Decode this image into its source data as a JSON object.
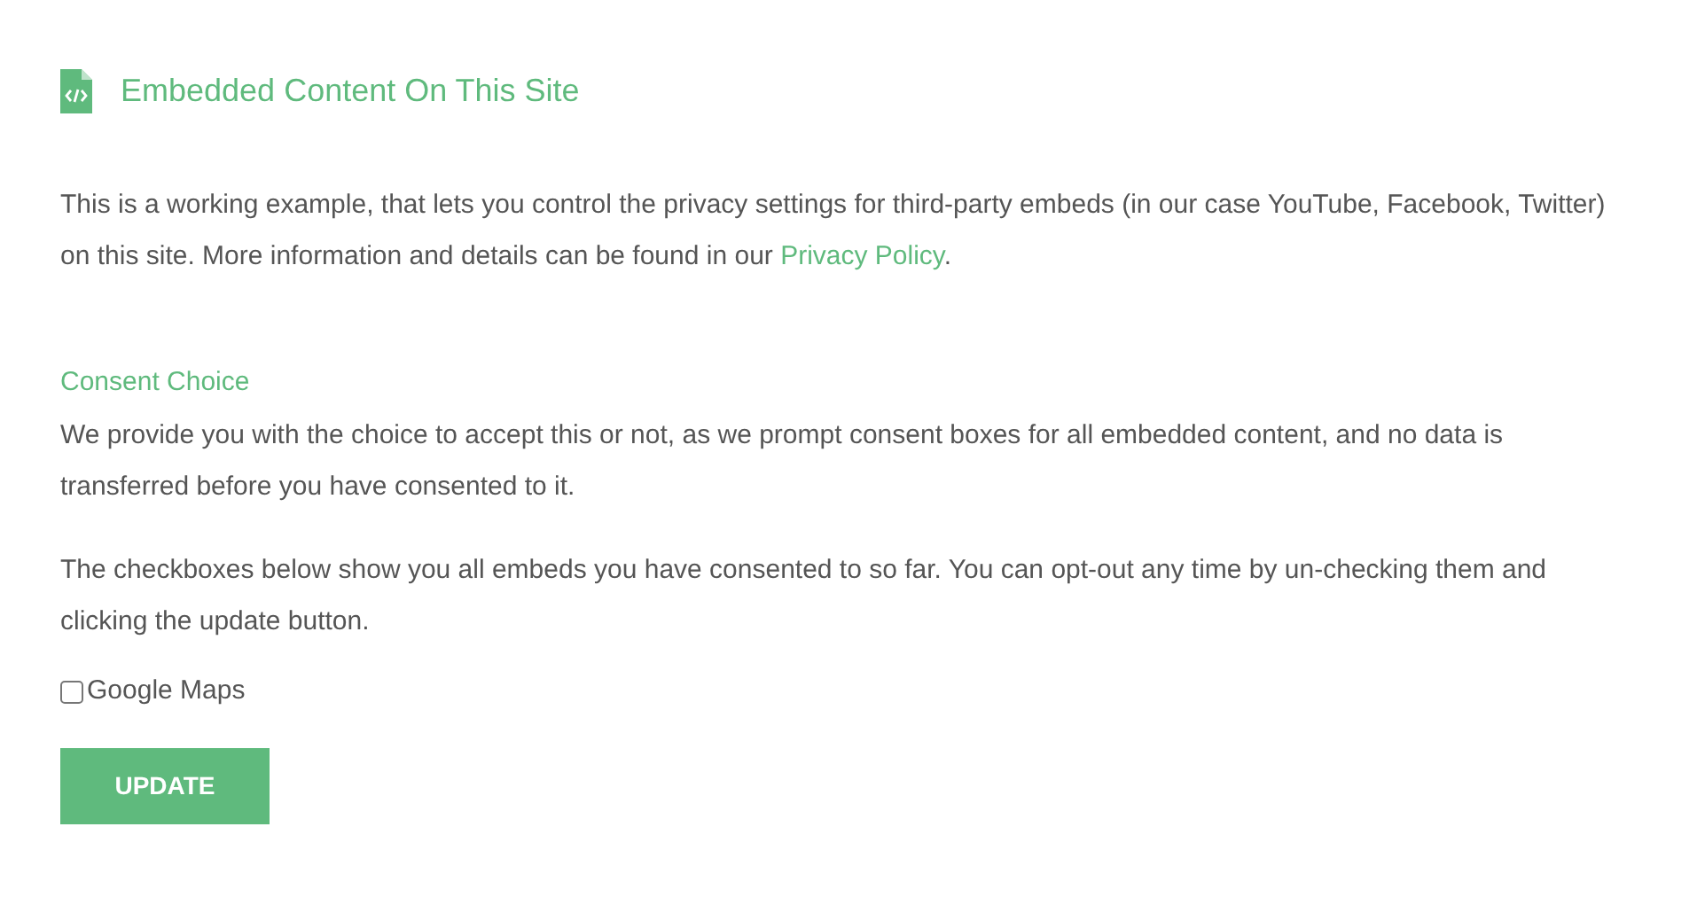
{
  "title": "Embedded Content On This Site",
  "intro": {
    "text": "This is a working example, that lets you control the privacy settings for third-party embeds (in our case YouTube, Facebook, Twitter) on this site. More information and details can be found in our ",
    "link": "Privacy Policy",
    "end": "."
  },
  "section_heading": "Consent Choice",
  "paragraphs": [
    "We provide you with the choice to accept this or not, as we prompt consent boxes for all embedded content, and no data is transferred before you have consented to it.",
    "The checkboxes below show you all embeds you have consented to so far. You can opt-out any time by un-checking them and clicking the update button."
  ],
  "embeds": [
    {
      "label": "Google Maps",
      "checked": false
    }
  ],
  "button": "UPDATE"
}
